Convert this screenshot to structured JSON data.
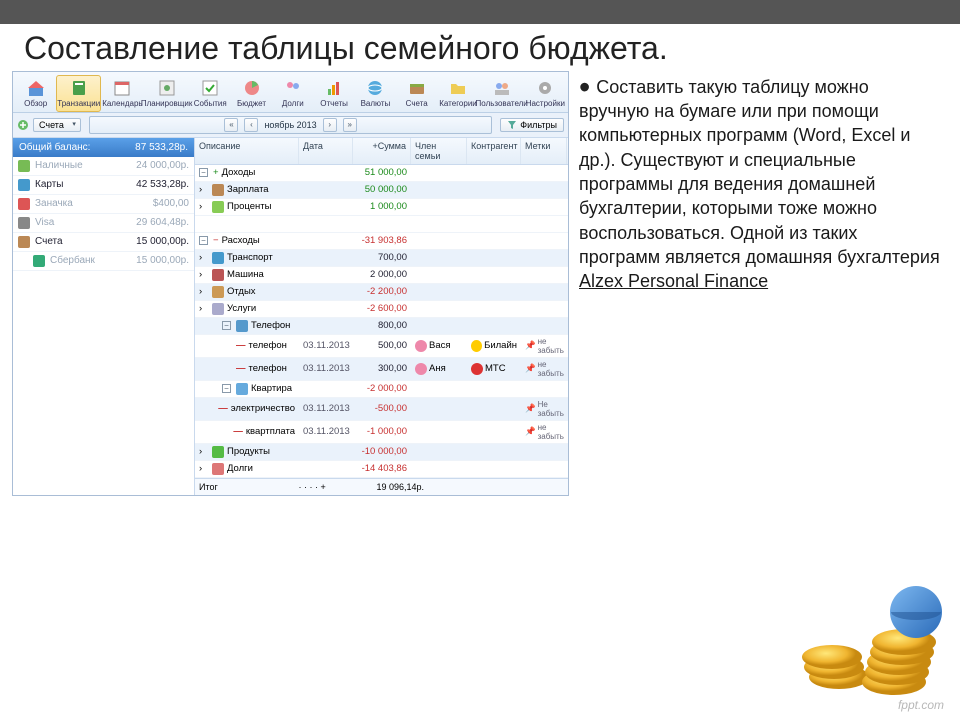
{
  "slide": {
    "title": "Составление таблицы семейного бюджета.",
    "body": "Составить такую таблицу можно вручную на бумаге или при помощи компьютерных программ (Word, Excel и др.). Существуют и специальные программы для ведения домашней бухгалтерии, которыми тоже можно воспользоваться. Одной из таких программ является домашняя бухгалтерия ",
    "link": "Alzex Personal Finance",
    "footer": "fppt.com"
  },
  "toolbar": [
    {
      "label": "Обзор",
      "icon": "home"
    },
    {
      "label": "Транзакции",
      "icon": "book",
      "active": true
    },
    {
      "label": "Календарь",
      "icon": "calendar"
    },
    {
      "label": "Планировщик",
      "icon": "plan"
    },
    {
      "label": "События",
      "icon": "check"
    },
    {
      "label": "Бюджет",
      "icon": "pie"
    },
    {
      "label": "Долги",
      "icon": "people"
    },
    {
      "label": "Отчеты",
      "icon": "chart"
    },
    {
      "label": "Валюты",
      "icon": "globe"
    },
    {
      "label": "Счета",
      "icon": "wallet"
    },
    {
      "label": "Категории",
      "icon": "folder"
    },
    {
      "label": "Пользователи",
      "icon": "users"
    },
    {
      "label": "Настройки",
      "icon": "gear"
    }
  ],
  "subbar": {
    "accounts_dd": "Счета",
    "period": "ноябрь 2013",
    "filter": "Фильтры"
  },
  "sidebar": {
    "headerLabel": "Общий баланс:",
    "headerAmount": "87 533,28р.",
    "rows": [
      {
        "name": "Наличные",
        "amount": "24 000,00р.",
        "icon": "cash",
        "dim": true
      },
      {
        "name": "Карты",
        "amount": "42 533,28р.",
        "icon": "cards"
      },
      {
        "name": "Заначка",
        "amount": "$400,00",
        "icon": "piggy",
        "dim": true
      },
      {
        "name": "Visa",
        "amount": "29 604,48р.",
        "icon": "visa",
        "dim": true
      },
      {
        "name": "Счета",
        "amount": "15 000,00р.",
        "icon": "wallet"
      },
      {
        "name": "Сбербанк",
        "amount": "15 000,00р.",
        "icon": "sber",
        "indent": true,
        "dim": true
      }
    ]
  },
  "grid": {
    "headers": {
      "desc": "Описание",
      "date": "Дата",
      "sum": "+Сумма",
      "member": "Член семьи",
      "agent": "Контрагент",
      "tags": "Метки"
    },
    "rows": [
      {
        "type": "group",
        "label": "Доходы",
        "sum": "51 000,00",
        "sign": "pos",
        "alt": false
      },
      {
        "type": "cat",
        "label": "Зарплата",
        "sum": "50 000,00",
        "sign": "pos",
        "icon": "wallet",
        "alt": true
      },
      {
        "type": "cat",
        "label": "Проценты",
        "sum": "1 000,00",
        "sign": "pos",
        "icon": "pct",
        "alt": false
      },
      {
        "type": "spacer"
      },
      {
        "type": "group",
        "label": "Расходы",
        "sum": "-31 903,86",
        "sign": "neg",
        "alt": false
      },
      {
        "type": "cat",
        "label": "Транспорт",
        "sum": "700,00",
        "sign": "neutral",
        "icon": "bus",
        "alt": true
      },
      {
        "type": "cat",
        "label": "Машина",
        "sum": "2 000,00",
        "sign": "neutral",
        "icon": "car",
        "alt": false
      },
      {
        "type": "cat",
        "label": "Отдых",
        "sum": "-2 200,00",
        "sign": "neg",
        "icon": "rest",
        "alt": true
      },
      {
        "type": "catopen",
        "label": "Услуги",
        "sum": "-2 600,00",
        "sign": "neg",
        "icon": "svc",
        "alt": false
      },
      {
        "type": "sub",
        "label": "Телефон",
        "sum": "800,00",
        "sign": "neutral",
        "icon": "phone",
        "alt": true
      },
      {
        "type": "item",
        "label": "телефон",
        "date": "03.11.2013",
        "sum": "500,00",
        "sign": "neutral",
        "member": "Вася",
        "agent": "Билайн",
        "tag": "не забыть",
        "alt": false
      },
      {
        "type": "item",
        "label": "телефон",
        "date": "03.11.2013",
        "sum": "300,00",
        "sign": "neutral",
        "member": "Аня",
        "agent": "МТС",
        "tag": "не забыть",
        "alt": true
      },
      {
        "type": "subopen",
        "label": "Квартира",
        "sum": "-2 000,00",
        "sign": "neg",
        "icon": "house",
        "alt": false
      },
      {
        "type": "item",
        "label": "электричество",
        "date": "03.11.2013",
        "sum": "-500,00",
        "sign": "neg",
        "tag": "Не забыть",
        "alt": true
      },
      {
        "type": "item",
        "label": "квартплата",
        "date": "03.11.2013",
        "sum": "-1 000,00",
        "sign": "neg",
        "tag": "не забыть",
        "alt": false
      },
      {
        "type": "cat",
        "label": "Продукты",
        "sum": "-10 000,00",
        "sign": "neg",
        "icon": "apple",
        "alt": true
      },
      {
        "type": "cat",
        "label": "Долги",
        "sum": "-14 403,86",
        "sign": "neg",
        "icon": "debt",
        "alt": false
      }
    ],
    "footer": {
      "label": "Итог",
      "sum": "19 096,14р."
    }
  }
}
